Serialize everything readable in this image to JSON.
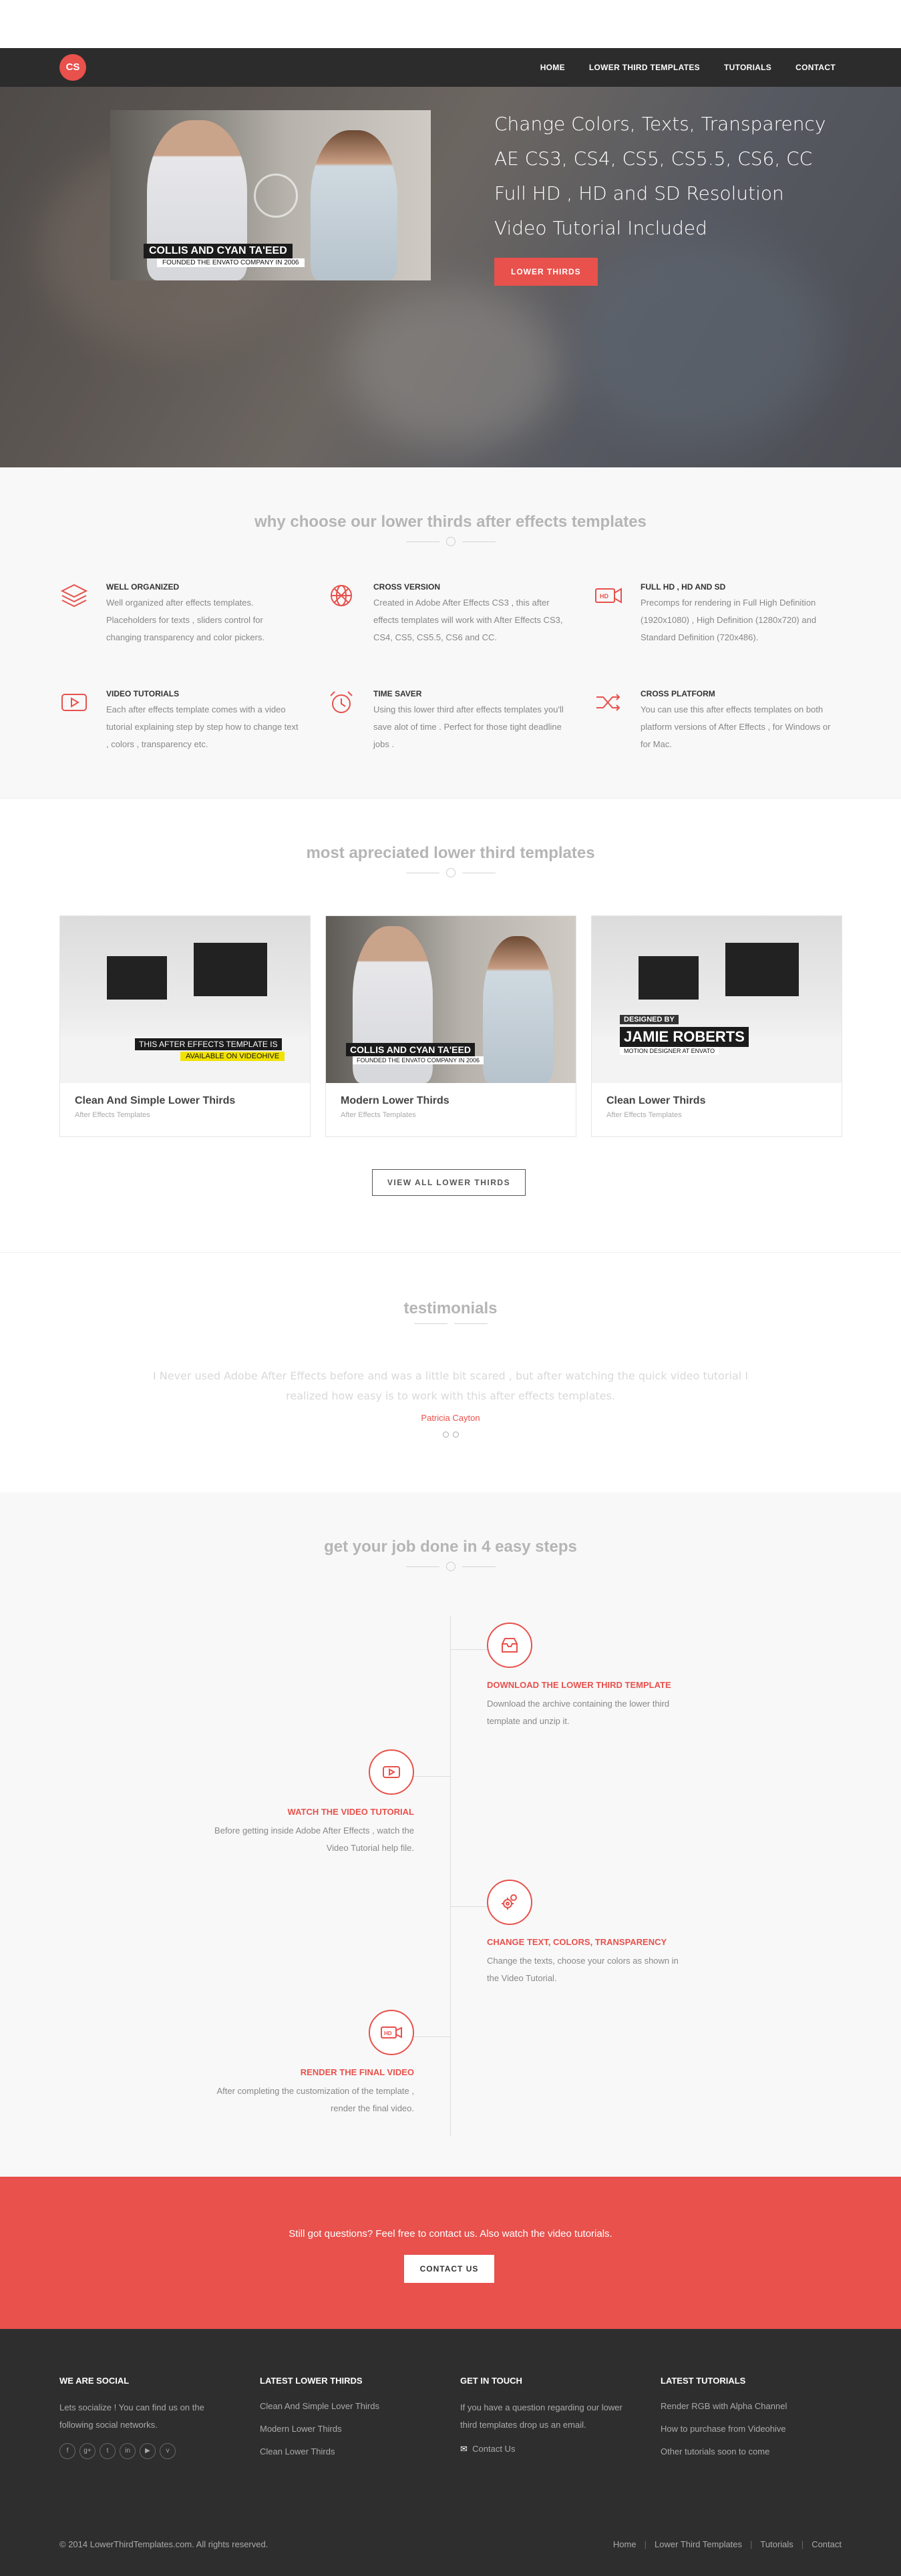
{
  "brand": {
    "logo_text": "CS",
    "accent": "#e8514c"
  },
  "nav": {
    "items": [
      "HOME",
      "LOWER THIRD TEMPLATES",
      "TUTORIALS",
      "CONTACT"
    ]
  },
  "hero": {
    "lines": [
      "Change Colors, Texts, Transparency",
      "AE CS3, CS4, CS5, CS5.5, CS6, CC",
      "Full HD , HD and SD Resolution",
      "Video Tutorial Included"
    ],
    "button": "LOWER THIRDS",
    "image_title": "COLLIS AND CYAN TA'EED",
    "image_subtitle": "FOUNDED THE ENVATO COMPANY IN 2006"
  },
  "features": {
    "title": "why choose our lower thirds after effects templates",
    "items": [
      {
        "icon": "layers-icon",
        "title": "WELL ORGANIZED",
        "text": "Well organized after effects templates. Placeholders for texts , sliders control for changing transparency and color pickers."
      },
      {
        "icon": "globe-icon",
        "title": "CROSS VERSION",
        "text": "Created in Adobe After Effects CS3 , this after effects templates will work with After Effects CS3, CS4, CS5, CS5.5, CS6 and CC."
      },
      {
        "icon": "hd-camera-icon",
        "title": "FULL HD , HD AND SD",
        "text": "Precomps for rendering in Full High Definition (1920x1080) , High Definition (1280x720) and Standard Definition (720x486)."
      },
      {
        "icon": "play-icon",
        "title": "VIDEO TUTORIALS",
        "text": "Each after effects template comes with a video tutorial explaining step by step how to change text , colors , transparency etc."
      },
      {
        "icon": "alarm-clock-icon",
        "title": "TIME SAVER",
        "text": "Using this lower third after effects templates you'll save alot of time . Perfect for those tight deadline jobs ."
      },
      {
        "icon": "shuffle-icon",
        "title": "CROSS PLATFORM",
        "text": "You can use this after effects templates on both platform versions of After Effects , for Windows or for Mac."
      }
    ]
  },
  "portfolio": {
    "title": "most apreciated lower third templates",
    "cards": [
      {
        "title": "Clean And Simple Lower Thirds",
        "category": "After Effects Templates",
        "overlay1": "THIS AFTER EFFECTS TEMPLATE IS",
        "overlay2": "AVAILABLE ON VIDEOHIVE"
      },
      {
        "title": "Modern Lower Thirds",
        "category": "After Effects Templates",
        "overlay1": "COLLIS AND CYAN TA'EED",
        "overlay2": "FOUNDED THE ENVATO COMPANY IN 2006"
      },
      {
        "title": "Clean Lower Thirds",
        "category": "After Effects Templates",
        "overlay1": "DESIGNED BY",
        "overlay2": "JAMIE ROBERTS",
        "overlay3": "MOTION DESIGNER AT ENVATO"
      }
    ],
    "button": "VIEW ALL LOWER THIRDS"
  },
  "testimonials": {
    "title": "testimonials",
    "quote": "I Never used Adobe After Effects before and was a little bit scared , but after watching the quick video tutorial I realized how easy is to work with this after effects templates.",
    "author": "Patricia Cayton"
  },
  "steps": {
    "title": "get your job done in 4 easy steps",
    "items": [
      {
        "icon": "download-box-icon",
        "title": "DOWNLOAD THE LOWER THIRD TEMPLATE",
        "text": "Download the archive containing the lower third template and unzip it."
      },
      {
        "icon": "play-icon",
        "title": "WATCH THE VIDEO TUTORIAL",
        "text": "Before getting inside Adobe After Effects , watch the Video Tutorial help file."
      },
      {
        "icon": "gears-icon",
        "title": "CHANGE TEXT, COLORS, TRANSPARENCY",
        "text": "Change the texts, choose your colors as shown in the Video Tutorial."
      },
      {
        "icon": "hd-camera-icon",
        "title": "RENDER THE FINAL VIDEO",
        "text": "After completing the customization of the template , render the final video."
      }
    ]
  },
  "cta": {
    "text": "Still got questions? Feel free to contact us. Also watch the video tutorials.",
    "button": "CONTACT US"
  },
  "footer": {
    "social": {
      "title": "WE ARE SOCIAL",
      "text": "Lets socialize ! You can find us on the following social networks.",
      "icons": [
        "f",
        "g+",
        "t",
        "in",
        "▶",
        "v"
      ]
    },
    "latest": {
      "title": "LATEST LOWER THIRDS",
      "links": [
        "Clean And Simple Lover Thirds",
        "Modern Lower Thirds",
        "Clean Lower Thirds"
      ]
    },
    "touch": {
      "title": "GET IN TOUCH",
      "text": "If you have a question regarding our lower third templates drop us an email.",
      "link": "Contact Us"
    },
    "tutorials": {
      "title": "LATEST TUTORIALS",
      "links": [
        "Render RGB with Alpha Channel",
        "How to purchase from Videohive",
        "Other tutorials soon to come"
      ]
    },
    "copyright": "© 2014 LowerThirdTemplates.com. All rights reserved.",
    "nav": [
      "Home",
      "Lower Third Templates",
      "Tutorials",
      "Contact"
    ]
  }
}
